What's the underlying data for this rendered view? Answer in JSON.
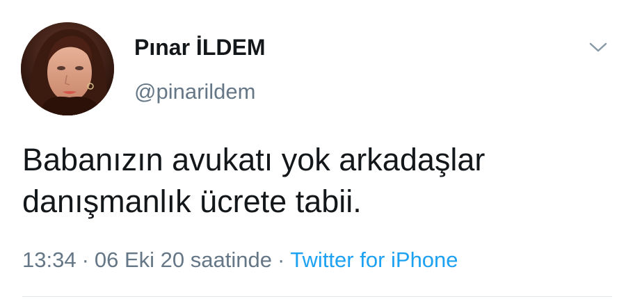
{
  "user": {
    "display_name": "Pınar İLDEM",
    "handle": "@pinarildem",
    "avatar_icon": "profile-photo"
  },
  "tweet": {
    "text_lines": [
      "Babanızın avukatı yok arkadaşlar",
      "danışmanlık ücrete tabii."
    ]
  },
  "meta": {
    "time": "13:34",
    "separator": "·",
    "date": "06 Eki 20 saatinde",
    "source": "Twitter for iPhone"
  },
  "menu": {
    "icon": "chevron-down-icon"
  },
  "colors": {
    "text": "#14171a",
    "muted": "#657786",
    "link": "#1da1f2",
    "divider": "#e1e8ed"
  }
}
